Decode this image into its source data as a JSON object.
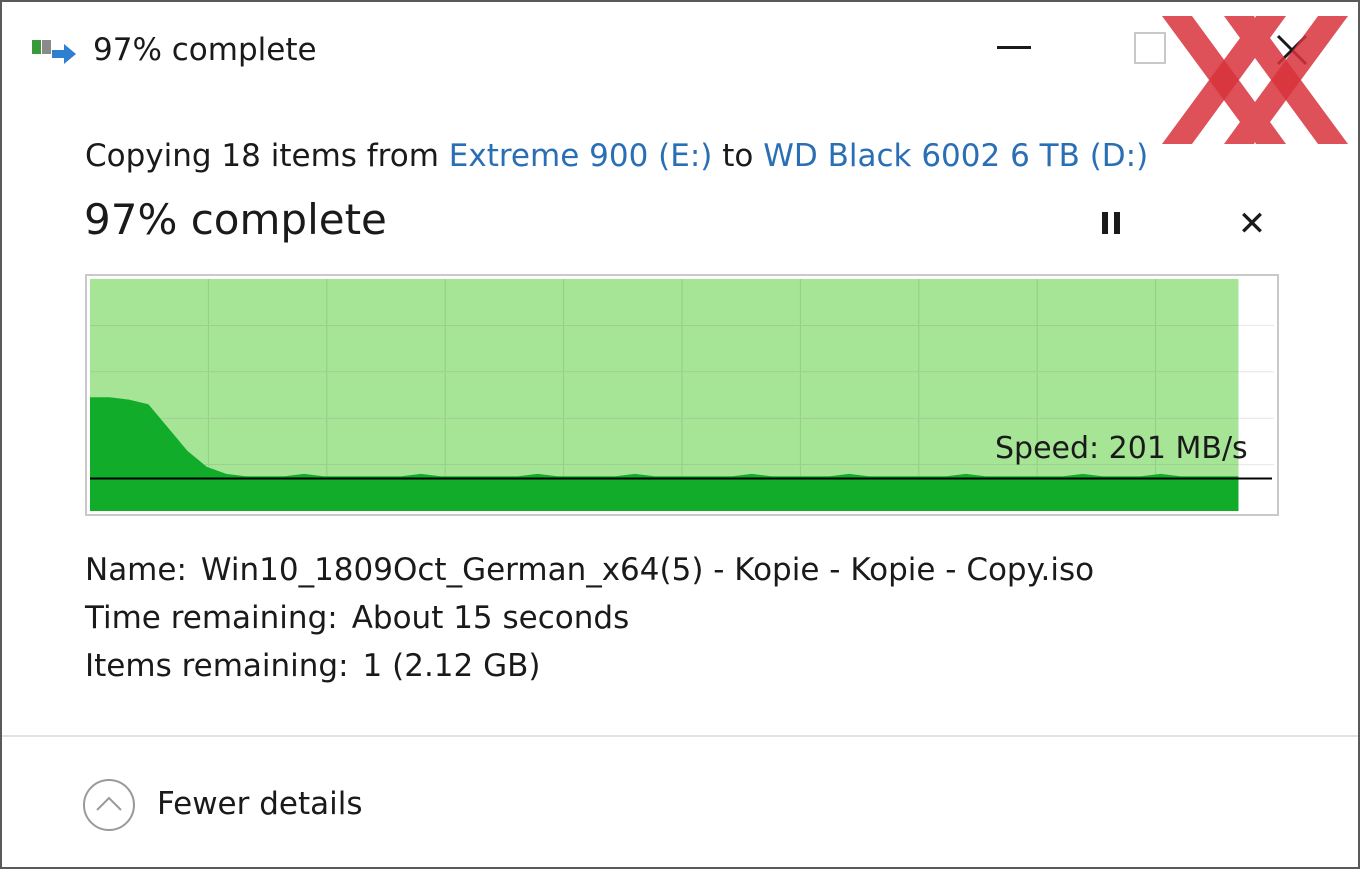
{
  "window": {
    "title": "97% complete"
  },
  "copy": {
    "prefix": "Copying 18 items from",
    "source": "Extreme 900 (E:)",
    "middle": "to",
    "destination": "WD Black 6002 6 TB (D:)"
  },
  "progress": {
    "title": "97% complete",
    "percent": 97
  },
  "graph": {
    "speed_label": "Speed: 201 MB/s",
    "colors": {
      "background": "#a6e496",
      "fill": "#12ac2b",
      "grid": "#8fd081",
      "speed_line": "#000000"
    },
    "speed_profile": [
      0.35,
      0.35,
      0.34,
      0.32,
      0.22,
      0.12,
      0.05,
      0.02,
      0.01,
      0.01,
      0.01,
      0.02,
      0.01,
      0.01,
      0.01,
      0.01,
      0.01,
      0.02,
      0.01,
      0.01,
      0.01,
      0.01,
      0.01,
      0.02,
      0.01,
      0.01,
      0.01,
      0.01,
      0.02,
      0.01,
      0.01,
      0.01,
      0.01,
      0.01,
      0.02,
      0.01,
      0.01,
      0.01,
      0.01,
      0.02,
      0.01,
      0.01,
      0.01,
      0.01,
      0.01,
      0.02,
      0.01,
      0.01,
      0.01,
      0.01,
      0.01,
      0.02,
      0.01,
      0.01,
      0.01,
      0.02,
      0.01,
      0.01,
      0.01,
      0.01
    ],
    "speed_line_level": 0.14
  },
  "details": {
    "name_label": "Name:",
    "name_value": "Win10_1809Oct_German_x64(5) - Kopie - Kopie - Copy.iso",
    "time_label": "Time remaining:",
    "time_value": "About 15 seconds",
    "items_label": "Items remaining:",
    "items_value": "1 (2.12 GB)"
  },
  "footer": {
    "fewer_details": "Fewer details"
  },
  "icons": {
    "app": "file-copy-icon",
    "minimize": "minimize-icon",
    "maximize": "maximize-icon",
    "close": "close-icon",
    "pause": "pause-icon",
    "cancel": "cancel-icon",
    "collapse": "chevron-up-icon"
  }
}
